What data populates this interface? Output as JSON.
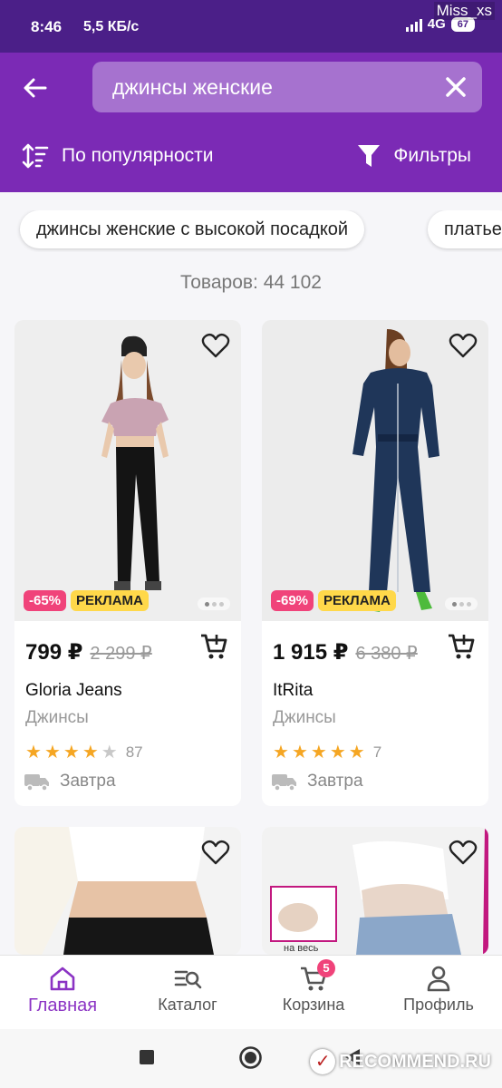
{
  "status_bar": {
    "time": "8:46",
    "speed": "5,5 КБ/с",
    "network": "4G",
    "battery": "67",
    "watermark": "Miss_xs"
  },
  "search": {
    "value": "джинсы женские"
  },
  "toolbar": {
    "sort_label": "По популярности",
    "filters_label": "Фильтры"
  },
  "suggestions": [
    "джинсы женские с высокой посадкой",
    "платье"
  ],
  "products_count": "Товаров: 44 102",
  "products": [
    {
      "discount": "-65%",
      "ad_label": "РЕКЛАМА",
      "price": "799 ₽",
      "old_price": "2 299 ₽",
      "brand": "Gloria Jeans",
      "type": "Джинсы",
      "stars": 4,
      "rating_count": "87",
      "delivery": "Завтра"
    },
    {
      "discount": "-69%",
      "ad_label": "РЕКЛАМА",
      "price": "1 915 ₽",
      "old_price": "6 380 ₽",
      "brand": "ItRita",
      "type": "Джинсы",
      "stars": 5,
      "rating_count": "7",
      "delivery": "Завтра"
    },
    {
      "image_caption": ""
    },
    {
      "image_caption": "на весь"
    }
  ],
  "bottom_nav": [
    {
      "label": "Главная",
      "icon": "home-icon",
      "active": true
    },
    {
      "label": "Каталог",
      "icon": "catalog-search-icon"
    },
    {
      "label": "Корзина",
      "icon": "cart-icon",
      "badge": "5"
    },
    {
      "label": "Профиль",
      "icon": "profile-icon"
    }
  ],
  "watermark_bottom": "RECOMMEND.RU",
  "colors": {
    "header": "#7b2ab5",
    "status_bar": "#4b1f88",
    "accent": "#8b33c4",
    "discount": "#f0437a",
    "ad": "#ffd84a",
    "star": "#f5a623"
  }
}
